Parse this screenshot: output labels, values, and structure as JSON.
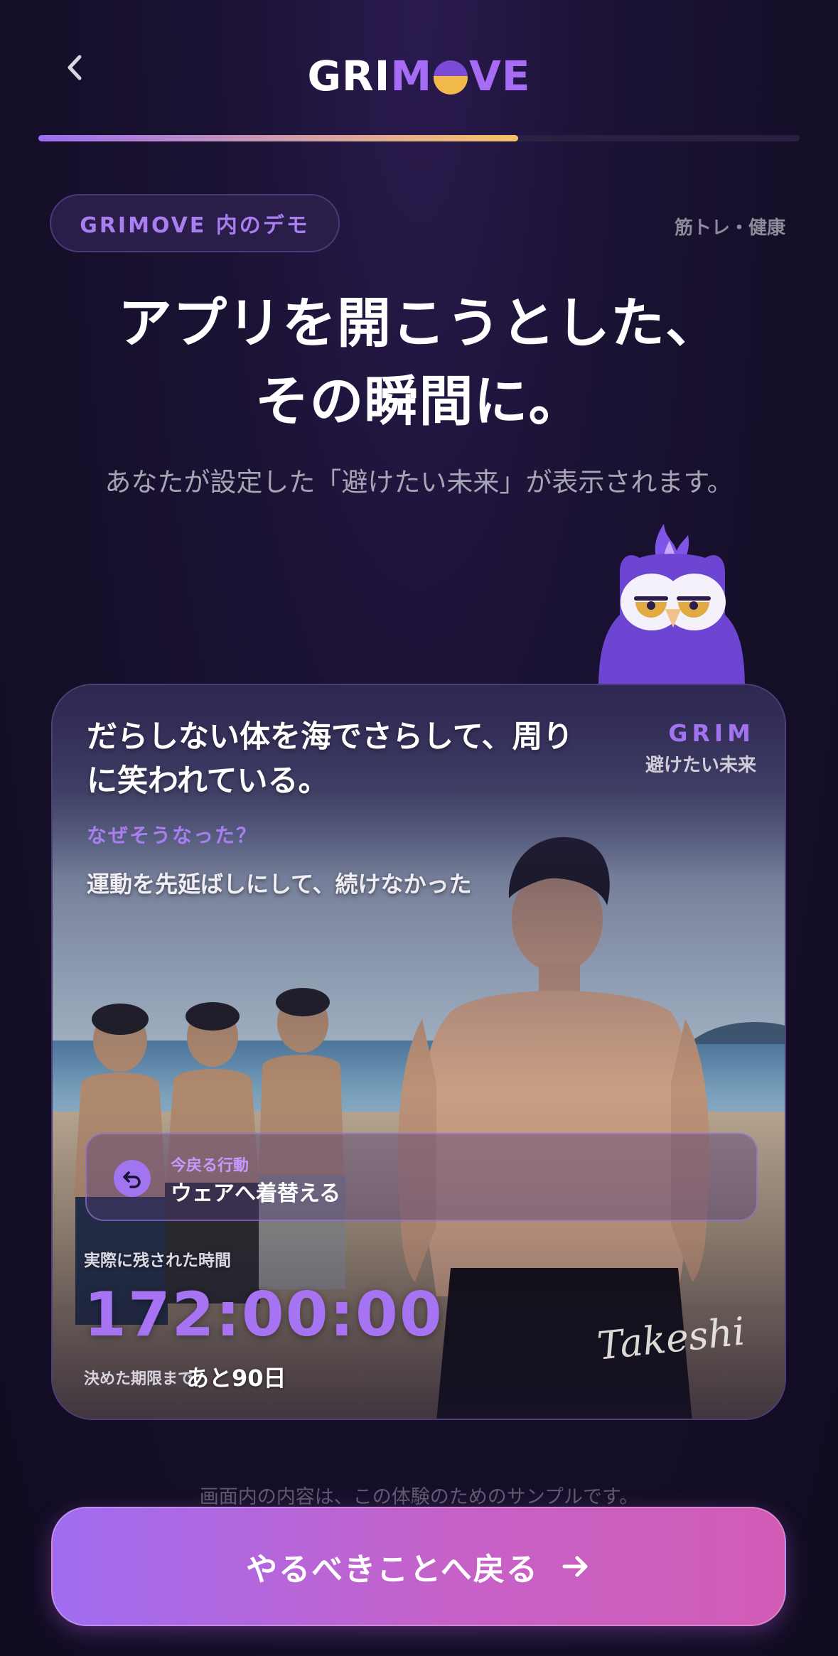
{
  "header": {
    "back_icon": "chevron-left-icon",
    "logo": {
      "part1": "GRI",
      "part2": "M",
      "part3": "VE"
    },
    "progress": 0.63
  },
  "tag": {
    "demo_label": "GRIMOVE 内のデモ",
    "category": "筋トレ・健康"
  },
  "headline": {
    "line1": "アプリを開こうとした、",
    "line2": "その瞬間に。"
  },
  "subtitle": "あなたが設定した「避けたい未来」が表示されます。",
  "card": {
    "title_line1": "だらしない体を海でさらして、周り",
    "title_line2": "に笑われている。",
    "grim_word": "GRIM",
    "grim_sub": "避けたい未来",
    "why_label": "なぜそうなった？",
    "why_text": "運動を先延ばしにして、続けなかった",
    "action_label": "今戻る行動",
    "action_text": "ウェアへ着替える",
    "action_icon": "undo-arrow-icon",
    "time_label": "実際に残された時間",
    "countdown": "172:00:00",
    "deadline_label": "決めた期限まで",
    "deadline_value": "あと90日",
    "signature": "Takeshi"
  },
  "footer": {
    "disclaimer": "画面内の内容は、この体験のためのサンプルです。",
    "cta_label": "やるべきことへ戻る",
    "cta_icon": "arrow-right-icon"
  },
  "colors": {
    "accent": "#a673f2",
    "background": "#140e27",
    "progress_end": "#f4c165",
    "cta_start": "#a06cf1",
    "cta_end": "#d15cb6"
  }
}
